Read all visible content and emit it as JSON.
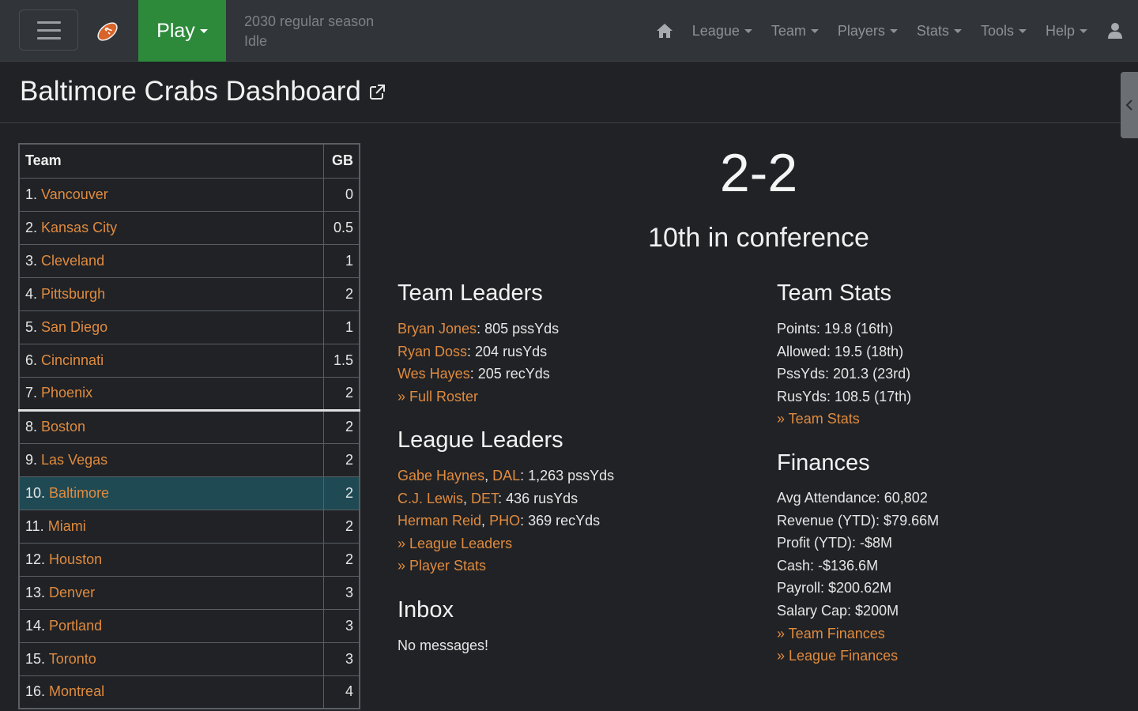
{
  "navbar": {
    "play_label": "Play",
    "status_line1": "2030 regular season",
    "status_line2": "Idle",
    "menu": [
      "League",
      "Team",
      "Players",
      "Stats",
      "Tools",
      "Help"
    ],
    "icons": [
      "hamburger-icon",
      "football-icon",
      "home-icon",
      "user-icon"
    ]
  },
  "page": {
    "title": "Baltimore Crabs Dashboard"
  },
  "standings": {
    "headers": {
      "team": "Team",
      "gb": "GB"
    },
    "rows": [
      {
        "rank": "1.",
        "team": "Vancouver",
        "gb": "0"
      },
      {
        "rank": "2.",
        "team": "Kansas City",
        "gb": "0.5"
      },
      {
        "rank": "3.",
        "team": "Cleveland",
        "gb": "1"
      },
      {
        "rank": "4.",
        "team": "Pittsburgh",
        "gb": "2"
      },
      {
        "rank": "5.",
        "team": "San Diego",
        "gb": "1"
      },
      {
        "rank": "6.",
        "team": "Cincinnati",
        "gb": "1.5"
      },
      {
        "rank": "7.",
        "team": "Phoenix",
        "gb": "2"
      },
      {
        "rank": "8.",
        "team": "Boston",
        "gb": "2"
      },
      {
        "rank": "9.",
        "team": "Las Vegas",
        "gb": "2"
      },
      {
        "rank": "10.",
        "team": "Baltimore",
        "gb": "2"
      },
      {
        "rank": "11.",
        "team": "Miami",
        "gb": "2"
      },
      {
        "rank": "12.",
        "team": "Houston",
        "gb": "2"
      },
      {
        "rank": "13.",
        "team": "Denver",
        "gb": "3"
      },
      {
        "rank": "14.",
        "team": "Portland",
        "gb": "3"
      },
      {
        "rank": "15.",
        "team": "Toronto",
        "gb": "3"
      },
      {
        "rank": "16.",
        "team": "Montreal",
        "gb": "4"
      }
    ]
  },
  "summary": {
    "record": "2-2",
    "conference_rank": "10th in conference"
  },
  "team_leaders": {
    "heading": "Team Leaders",
    "items": [
      {
        "name": "Bryan Jones",
        "stat": ": 805 pssYds"
      },
      {
        "name": "Ryan Doss",
        "stat": ": 204 rusYds"
      },
      {
        "name": "Wes Hayes",
        "stat": ": 205 recYds"
      }
    ],
    "link": "» Full Roster"
  },
  "league_leaders": {
    "heading": "League Leaders",
    "items": [
      {
        "name": "Gabe Haynes",
        "team": "DAL",
        "stat": ": 1,263 pssYds"
      },
      {
        "name": "C.J. Lewis",
        "team": "DET",
        "stat": ": 436 rusYds"
      },
      {
        "name": "Herman Reid",
        "team": "PHO",
        "stat": ": 369 recYds"
      }
    ],
    "links": [
      "» League Leaders",
      "» Player Stats"
    ]
  },
  "inbox": {
    "heading": "Inbox",
    "message": "No messages!"
  },
  "team_stats": {
    "heading": "Team Stats",
    "items": [
      "Points: 19.8 (16th)",
      "Allowed: 19.5 (18th)",
      "PssYds: 201.3 (23rd)",
      "RusYds: 108.5 (17th)"
    ],
    "link": "» Team Stats"
  },
  "finances": {
    "heading": "Finances",
    "items": [
      "Avg Attendance: 60,802",
      "Revenue (YTD): $79.66M",
      "Profit (YTD): -$8M",
      "Cash: -$136.6M",
      "Payroll: $200.62M",
      "Salary Cap: $200M"
    ],
    "links": [
      "» Team Finances",
      "» League Finances"
    ]
  },
  "colors": {
    "link": "#e08b3e",
    "play_button": "#2c8a3a",
    "highlight_row": "#1f4a54",
    "navbar": "#313439",
    "background": "#202226"
  }
}
